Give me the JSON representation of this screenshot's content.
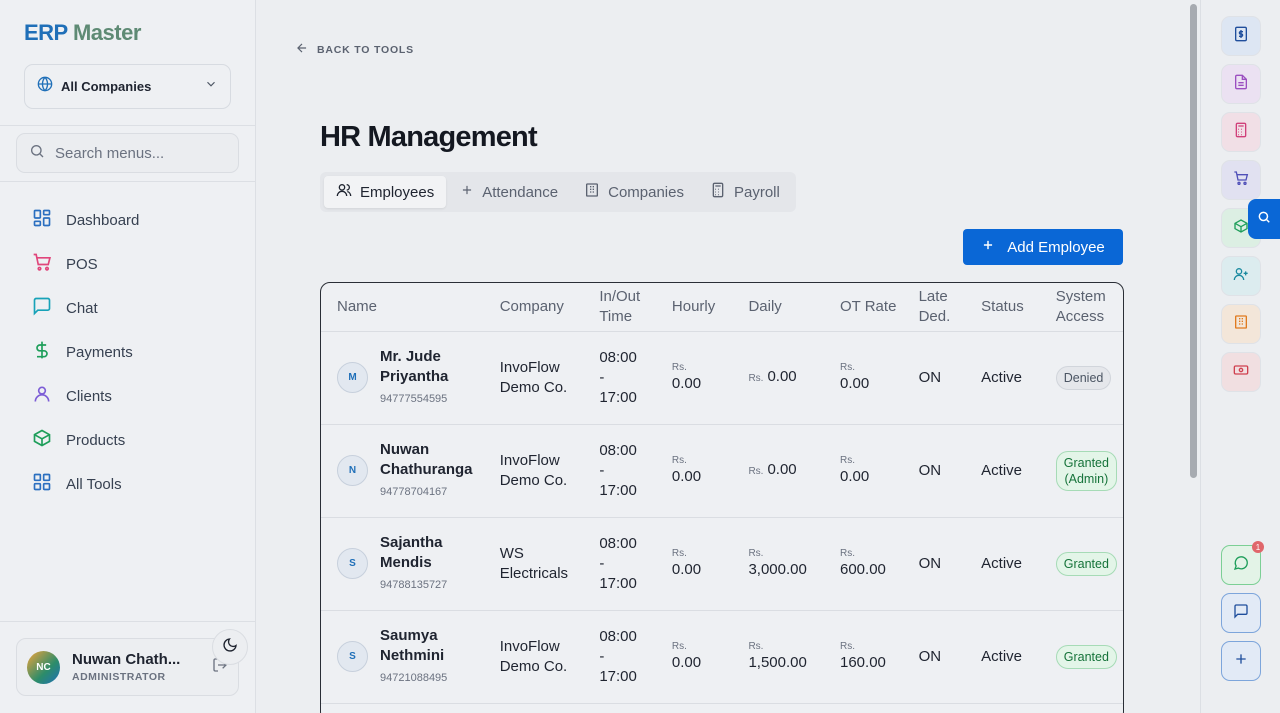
{
  "brand": {
    "part1": "ERP",
    "part2": "Master"
  },
  "company_select": {
    "label": "All Companies"
  },
  "search": {
    "placeholder": "Search menus..."
  },
  "nav": [
    {
      "label": "Dashboard",
      "icon": "dashboard-icon"
    },
    {
      "label": "POS",
      "icon": "cart-icon"
    },
    {
      "label": "Chat",
      "icon": "chat-icon"
    },
    {
      "label": "Payments",
      "icon": "dollar-icon"
    },
    {
      "label": "Clients",
      "icon": "user-icon"
    },
    {
      "label": "Products",
      "icon": "box-icon"
    },
    {
      "label": "All Tools",
      "icon": "grid-icon"
    }
  ],
  "user": {
    "initials": "NC",
    "name": "Nuwan Chath...",
    "role": "ADMINISTRATOR"
  },
  "back_link": "BACK TO TOOLS",
  "page_title": "HR Management",
  "tabs": [
    {
      "label": "Employees",
      "active": true
    },
    {
      "label": "Attendance",
      "active": false
    },
    {
      "label": "Companies",
      "active": false
    },
    {
      "label": "Payroll",
      "active": false
    }
  ],
  "add_button": "Add Employee",
  "table": {
    "headers": [
      "Name",
      "Company",
      "In/Out Time",
      "Hourly",
      "Daily",
      "OT Rate",
      "Late Ded.",
      "Status",
      "System Access"
    ],
    "currency": "Rs.",
    "rows": [
      {
        "initial": "M",
        "name": "Mr. Jude Priyantha",
        "phone": "94777554595",
        "company": "InvoFlow Demo Co.",
        "in": "08:00",
        "sep": "-",
        "out": "17:00",
        "hourly": "0.00",
        "daily": "0.00",
        "ot": "0.00",
        "late": "ON",
        "status": "Active",
        "access": "Denied"
      },
      {
        "initial": "N",
        "name": "Nuwan Chathuranga",
        "phone": "94778704167",
        "company": "InvoFlow Demo Co.",
        "in": "08:00",
        "sep": "-",
        "out": "17:00",
        "hourly": "0.00",
        "daily": "0.00",
        "ot": "0.00",
        "late": "ON",
        "status": "Active",
        "access": "Granted (Admin)"
      },
      {
        "initial": "S",
        "name": "Sajantha Mendis",
        "phone": "94788135727",
        "company": "WS Electricals",
        "in": "08:00",
        "sep": "-",
        "out": "17:00",
        "hourly": "0.00",
        "daily": "3,000.00",
        "ot": "600.00",
        "late": "ON",
        "status": "Active",
        "access": "Granted"
      },
      {
        "initial": "S",
        "name": "Saumya Nethmini",
        "phone": "94721088495",
        "company": "InvoFlow Demo Co.",
        "in": "08:00",
        "sep": "-",
        "out": "17:00",
        "hourly": "0.00",
        "daily": "1,500.00",
        "ot": "160.00",
        "late": "ON",
        "status": "Active",
        "access": "Granted"
      }
    ]
  },
  "rail": {
    "buttons": [
      "invoice-icon",
      "document-icon",
      "calculator-icon",
      "cart-icon",
      "box-icon",
      "add-user-icon",
      "building-icon",
      "cash-icon"
    ],
    "bottom": [
      "whatsapp-icon",
      "message-icon",
      "plus-icon"
    ],
    "notification_count": "1"
  },
  "colors": {
    "accent": "#0a67d6",
    "brand_green": "#5e8a74",
    "granted": "#16733a"
  }
}
